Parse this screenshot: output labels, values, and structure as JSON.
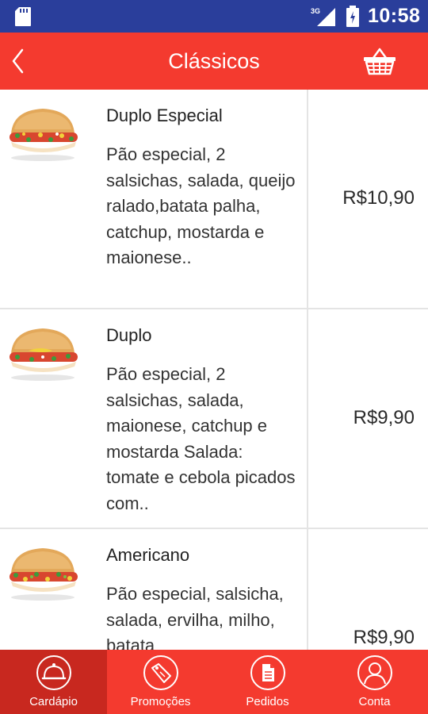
{
  "status_bar": {
    "network": "3G",
    "time": "10:58"
  },
  "app_bar": {
    "title": "Clássicos",
    "back_icon": "chevron-left-icon",
    "cart_icon": "basket-icon"
  },
  "products": [
    {
      "name": "Duplo Especial",
      "description": "Pão especial, 2 salsichas, salada, queijo ralado,batata palha, catchup, mostarda e maionese..",
      "price": "R$10,90"
    },
    {
      "name": "Duplo",
      "description": "Pão especial, 2 salsichas, salada, maionese, catchup e mostarda Salada: tomate e cebola picados com..",
      "price": "R$9,90"
    },
    {
      "name": "Americano",
      "description": "Pão especial, salsicha, salada, ervilha, milho, batata",
      "price": "R$9,90"
    }
  ],
  "bottom_nav": [
    {
      "label": "Cardápio",
      "icon": "cloche-icon",
      "active": true
    },
    {
      "label": "Promoções",
      "icon": "tag-icon",
      "active": false
    },
    {
      "label": "Pedidos",
      "icon": "document-icon",
      "active": false
    },
    {
      "label": "Conta",
      "icon": "user-icon",
      "active": false
    }
  ],
  "colors": {
    "status_bar": "#2a3e9b",
    "primary": "#f43a2f",
    "nav_active": "#c8281f"
  }
}
